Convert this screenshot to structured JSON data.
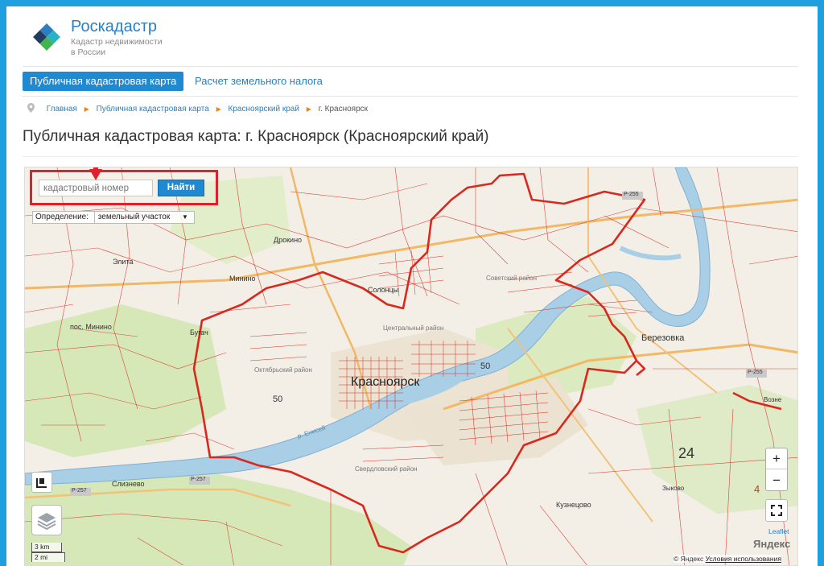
{
  "brand": {
    "title": "Роскадастр",
    "subtitle_line1": "Кадастр недвижимости",
    "subtitle_line2": "в России"
  },
  "nav": {
    "active_tab": "Публичная кадастровая карта",
    "tab2": "Расчет земельного налога"
  },
  "breadcrumb": {
    "items": [
      "Главная",
      "Публичная кадастровая карта",
      "Красноярский край"
    ],
    "current": "г. Красноярск"
  },
  "page_title": "Публичная кадастровая карта: г. Красноярск (Красноярский край)",
  "search": {
    "placeholder": "кадастровый номер",
    "button_label": "Найти"
  },
  "definition": {
    "label": "Определение:",
    "value": "земельный участок"
  },
  "map_labels": {
    "city": "Красноярск",
    "berezovka": "Березовка",
    "soltsy": "Солонцы",
    "drokino": "Дрокино",
    "elita": "Элита",
    "minino": "Минино",
    "pos_minino": "пос. Минино",
    "bugach": "Бугач",
    "kuznetsovo": "Кузнецово",
    "sliznevo": "Слизнево",
    "num_50_a": "50",
    "num_50_b": "50",
    "num_24": "24",
    "road_p255_a": "Р-255",
    "road_p255_b": "Р-255",
    "road_p257": "Р-257",
    "road_p257_b": "Р-257",
    "vozne": "Возне",
    "enisey": "р. Енисей",
    "sovetsky": "Советский район",
    "centralny": "Центральный район",
    "oktyabrsky": "Октябрьский район",
    "sverdlovsky": "Свердловский район",
    "zykovo": "Зыково",
    "num_4": "4"
  },
  "controls": {
    "zoom_in": "+",
    "zoom_out": "−",
    "scale_km": "3 km",
    "scale_mi": "2 mi",
    "leaflet": "Leaflet",
    "yandex": "Яндекс",
    "attribution_prefix": "© Яндекс",
    "terms": "Условия использования"
  },
  "colors": {
    "accent": "#1f8ad2",
    "highlight_red": "#e0202a",
    "cadastral_red": "#d9281e"
  }
}
